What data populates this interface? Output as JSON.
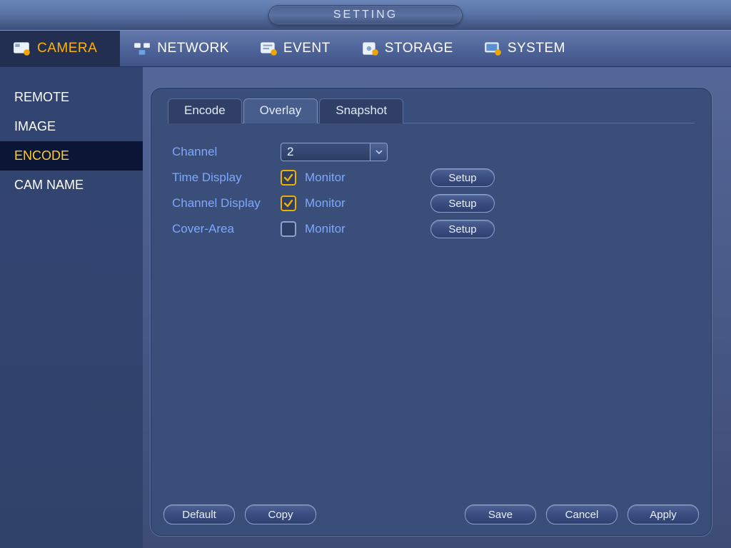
{
  "window": {
    "title": "SETTING"
  },
  "maintabs": [
    {
      "id": "camera",
      "label": "CAMERA",
      "active": true
    },
    {
      "id": "network",
      "label": "NETWORK",
      "active": false
    },
    {
      "id": "event",
      "label": "EVENT",
      "active": false
    },
    {
      "id": "storage",
      "label": "STORAGE",
      "active": false
    },
    {
      "id": "system",
      "label": "SYSTEM",
      "active": false
    }
  ],
  "sidebar": {
    "items": [
      {
        "id": "remote",
        "label": "REMOTE",
        "active": false
      },
      {
        "id": "image",
        "label": "IMAGE",
        "active": false
      },
      {
        "id": "encode",
        "label": "ENCODE",
        "active": true
      },
      {
        "id": "camname",
        "label": "CAM NAME",
        "active": false
      }
    ]
  },
  "subtabs": [
    {
      "id": "encode",
      "label": "Encode",
      "active": false
    },
    {
      "id": "overlay",
      "label": "Overlay",
      "active": true
    },
    {
      "id": "snapshot",
      "label": "Snapshot",
      "active": false
    }
  ],
  "form": {
    "channel_label": "Channel",
    "channel_value": "2",
    "time_display_label": "Time Display",
    "channel_display_label": "Channel Display",
    "cover_area_label": "Cover-Area",
    "monitor_label": "Monitor",
    "setup_label": "Setup",
    "time_display_checked": true,
    "channel_display_checked": true,
    "cover_area_checked": false
  },
  "footer": {
    "default": "Default",
    "copy": "Copy",
    "save": "Save",
    "cancel": "Cancel",
    "apply": "Apply"
  }
}
